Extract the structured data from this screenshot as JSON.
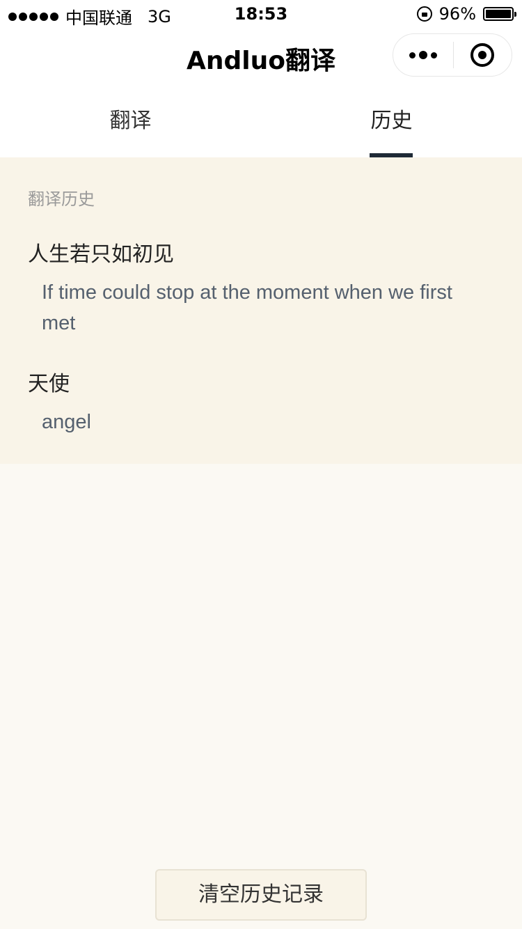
{
  "status_bar": {
    "carrier": "中国联通",
    "network": "3G",
    "time": "18:53",
    "battery": "96%"
  },
  "nav": {
    "title": "Andluo翻译"
  },
  "tabs": [
    {
      "label": "翻译"
    },
    {
      "label": "历史"
    }
  ],
  "history": {
    "heading": "翻译历史",
    "items": [
      {
        "source": "人生若只如初见",
        "result": "If time could stop at the moment when we first met"
      },
      {
        "source": "天使",
        "result": "angel"
      }
    ],
    "clear_label": "清空历史记录"
  },
  "colors": {
    "panel_bg": "#f9f4e8",
    "page_bg": "#fbf9f3",
    "tab_indicator": "#1f2a36",
    "result_text": "#55606e"
  }
}
